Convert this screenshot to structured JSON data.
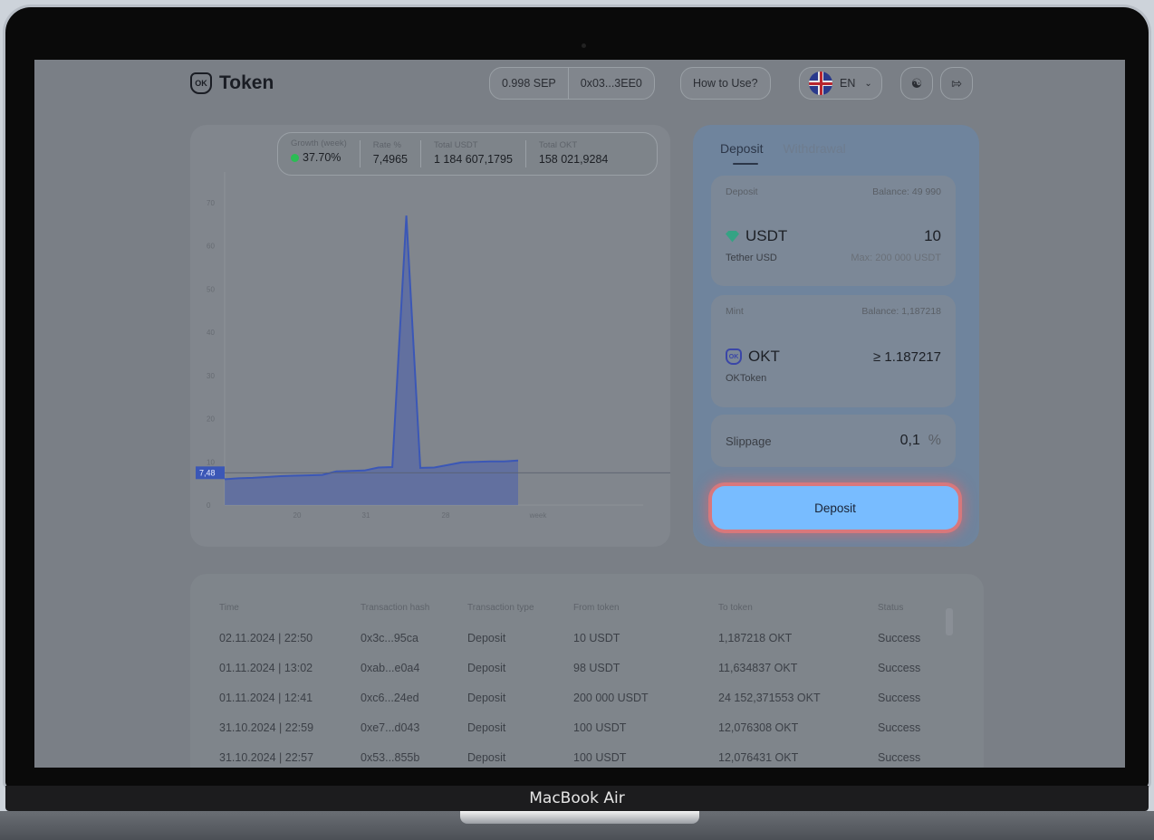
{
  "device_label": "MacBook Air",
  "header": {
    "logo_mark": "OK",
    "logo_text": "Token",
    "balance": "0.998 SEP",
    "wallet": "0x03...3EE0",
    "how_to_use": "How to Use?",
    "language": "EN"
  },
  "stats": [
    {
      "label": "Growth (week)",
      "value": "37.70%"
    },
    {
      "label": "Rate %",
      "value": "7,4965"
    },
    {
      "label": "Total USDT",
      "value": "1 184 607,1795"
    },
    {
      "label": "Total OKT",
      "value": "158 021,9284"
    }
  ],
  "chart_data": {
    "type": "area",
    "x": [
      0,
      1,
      2,
      3,
      4,
      5,
      6,
      7,
      8,
      9,
      10,
      11,
      12,
      13,
      14,
      15,
      16,
      17,
      18,
      19,
      20,
      21
    ],
    "values": [
      6.0,
      6.2,
      6.3,
      6.5,
      6.7,
      6.8,
      6.9,
      7.0,
      7.8,
      7.9,
      8.0,
      8.7,
      8.8,
      67.0,
      8.6,
      8.7,
      9.3,
      9.9,
      10.0,
      10.1,
      10.1,
      10.3
    ],
    "x_tick_labels": [
      "20",
      "31",
      "28",
      "week"
    ],
    "y_tick_labels": [
      "70",
      "60",
      "50",
      "40",
      "30",
      "20",
      "10",
      "0"
    ],
    "ylim": [
      0,
      75
    ],
    "current_marker": "7,48",
    "current_value": 7.48,
    "color": "#3b57b6"
  },
  "deposit_panel": {
    "tabs": [
      "Deposit",
      "Withdrawal"
    ],
    "deposit_card": {
      "label": "Deposit",
      "balance": "Balance: 49 990",
      "token": "USDT",
      "token_name": "Tether USD",
      "amount": "10",
      "max": "Max: 200 000 USDT"
    },
    "mint_card": {
      "label": "Mint",
      "balance": "Balance: 1,187218",
      "token": "OKT",
      "token_name": "OKToken",
      "amount": "≥ 1.187217"
    },
    "slippage": {
      "label": "Slippage",
      "value": "0,1",
      "unit": "%"
    },
    "button": "Deposit"
  },
  "table": {
    "headers": [
      "Time",
      "Transaction hash",
      "Transaction type",
      "From token",
      "To token",
      "Status"
    ],
    "rows": [
      [
        "02.11.2024 | 22:50",
        "0x3c...95ca",
        "Deposit",
        "10 USDT",
        "1,187218 OKT",
        "Success"
      ],
      [
        "01.11.2024 | 13:02",
        "0xab...e0a4",
        "Deposit",
        "98 USDT",
        "11,634837 OKT",
        "Success"
      ],
      [
        "01.11.2024 | 12:41",
        "0xc6...24ed",
        "Deposit",
        "200 000 USDT",
        "24 152,371553 OKT",
        "Success"
      ],
      [
        "31.10.2024 | 22:59",
        "0xe7...d043",
        "Deposit",
        "100 USDT",
        "12,076308 OKT",
        "Success"
      ],
      [
        "31.10.2024 | 22:57",
        "0x53...855b",
        "Deposit",
        "100 USDT",
        "12,076431 OKT",
        "Success"
      ]
    ]
  }
}
